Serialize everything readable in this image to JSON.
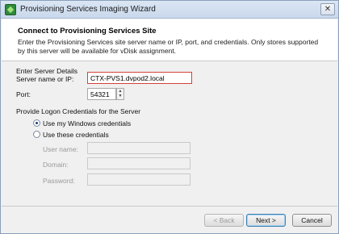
{
  "window": {
    "title": "Provisioning Services Imaging Wizard",
    "close_glyph": "✕"
  },
  "header": {
    "title": "Connect to Provisioning Services Site",
    "description": "Enter the Provisioning Services site server name or IP, port, and credentials. Only stores supported by this server will be available for vDisk assignment."
  },
  "server": {
    "section_label": "Enter Server Details",
    "name_label": "Server name or IP:",
    "name_value": "CTX-PVS1.dvpod2.local",
    "port_label": "Port:",
    "port_value": "54321",
    "spin_up": "▲",
    "spin_down": "▼"
  },
  "credentials": {
    "section_label": "Provide Logon Credentials for the Server",
    "option_windows": "Use my Windows credentials",
    "option_these": "Use these credentials",
    "selected": "windows",
    "username_label": "User name:",
    "domain_label": "Domain:",
    "password_label": "Password:"
  },
  "buttons": {
    "back": "< Back",
    "next": "Next >",
    "cancel": "Cancel"
  }
}
